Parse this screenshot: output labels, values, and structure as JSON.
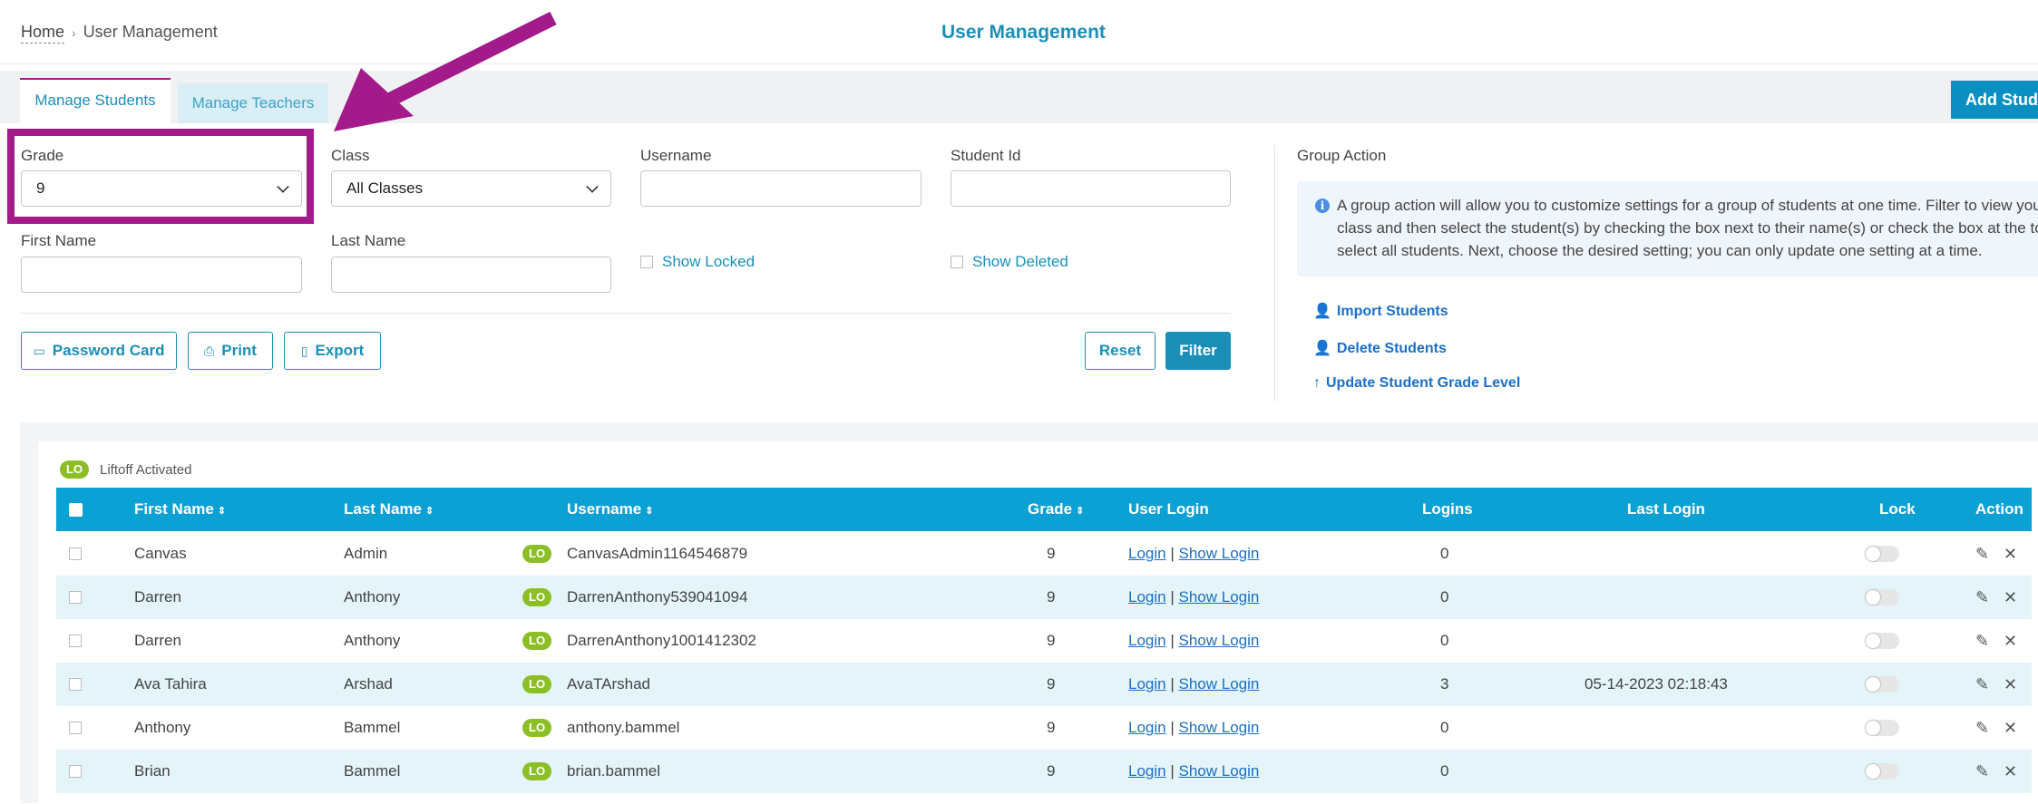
{
  "breadcrumb": {
    "home": "Home",
    "current": "User Management"
  },
  "page_title": "User Management",
  "tabs": [
    {
      "label": "Manage Students"
    },
    {
      "label": "Manage Teachers"
    }
  ],
  "add_button": "Add Stude",
  "filters": {
    "grade": {
      "label": "Grade",
      "value": "9"
    },
    "class": {
      "label": "Class",
      "value": "All Classes"
    },
    "username": {
      "label": "Username",
      "value": ""
    },
    "student_id": {
      "label": "Student Id",
      "value": ""
    },
    "first_name": {
      "label": "First Name",
      "value": ""
    },
    "last_name": {
      "label": "Last Name",
      "value": ""
    },
    "show_locked": "Show Locked",
    "show_deleted": "Show Deleted"
  },
  "buttons": {
    "password_card": "Password Card",
    "print": "Print",
    "export": "Export",
    "reset": "Reset",
    "filter": "Filter"
  },
  "group_action": {
    "title": "Group Action",
    "info_lines": [
      "A group action will allow you to customize settings for a group of students at one time. Filter to view your",
      "class and then select the student(s) by checking the box next to their name(s) or check the box at the top",
      "select all students. Next, choose the desired setting; you can only update one setting at a time."
    ],
    "links": [
      "Import Students",
      "Delete Students",
      "Update Student Grade Level"
    ]
  },
  "legend": {
    "badge": "LO",
    "text": "Liftoff Activated"
  },
  "table": {
    "headers": {
      "first_name": "First Name",
      "last_name": "Last Name",
      "username": "Username",
      "grade": "Grade",
      "user_login": "User Login",
      "logins": "Logins",
      "last_login": "Last Login",
      "lock": "Lock",
      "action": "Action"
    },
    "login_link": "Login",
    "show_login_link": "Show Login",
    "separator": "|",
    "rows": [
      {
        "first": "Canvas",
        "last": "Admin",
        "username": "CanvasAdmin1164546879",
        "grade": "9",
        "logins": "0",
        "last_login": ""
      },
      {
        "first": "Darren",
        "last": "Anthony",
        "username": "DarrenAnthony539041094",
        "grade": "9",
        "logins": "0",
        "last_login": ""
      },
      {
        "first": "Darren",
        "last": "Anthony",
        "username": "DarrenAnthony1001412302",
        "grade": "9",
        "logins": "0",
        "last_login": ""
      },
      {
        "first": "Ava Tahira",
        "last": "Arshad",
        "username": "AvaTArshad",
        "grade": "9",
        "logins": "3",
        "last_login": "05-14-2023 02:18:43"
      },
      {
        "first": "Anthony",
        "last": "Bammel",
        "username": "anthony.bammel",
        "grade": "9",
        "logins": "0",
        "last_login": ""
      },
      {
        "first": "Brian",
        "last": "Bammel",
        "username": "brian.bammel",
        "grade": "9",
        "logins": "0",
        "last_login": ""
      }
    ]
  },
  "colors": {
    "accent": "#1b8fb8",
    "header": "#0ba1d5",
    "highlight": "#a31a8a",
    "badge": "#8cbf26"
  }
}
